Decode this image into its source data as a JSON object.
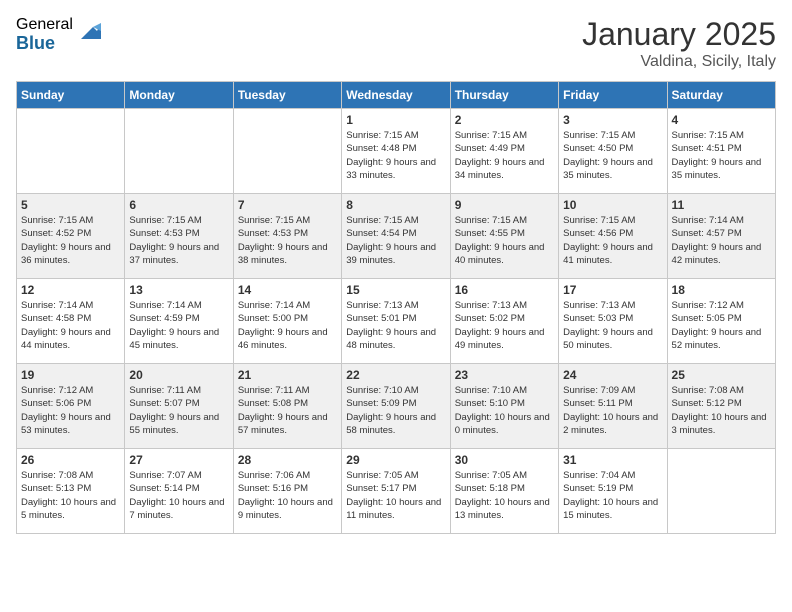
{
  "logo": {
    "general": "General",
    "blue": "Blue"
  },
  "header": {
    "month": "January 2025",
    "location": "Valdina, Sicily, Italy"
  },
  "weekdays": [
    "Sunday",
    "Monday",
    "Tuesday",
    "Wednesday",
    "Thursday",
    "Friday",
    "Saturday"
  ],
  "weeks": [
    [
      null,
      null,
      null,
      {
        "day": "1",
        "sunrise": "7:15 AM",
        "sunset": "4:48 PM",
        "daylight": "9 hours and 33 minutes."
      },
      {
        "day": "2",
        "sunrise": "7:15 AM",
        "sunset": "4:49 PM",
        "daylight": "9 hours and 34 minutes."
      },
      {
        "day": "3",
        "sunrise": "7:15 AM",
        "sunset": "4:50 PM",
        "daylight": "9 hours and 35 minutes."
      },
      {
        "day": "4",
        "sunrise": "7:15 AM",
        "sunset": "4:51 PM",
        "daylight": "9 hours and 35 minutes."
      }
    ],
    [
      {
        "day": "5",
        "sunrise": "7:15 AM",
        "sunset": "4:52 PM",
        "daylight": "9 hours and 36 minutes."
      },
      {
        "day": "6",
        "sunrise": "7:15 AM",
        "sunset": "4:53 PM",
        "daylight": "9 hours and 37 minutes."
      },
      {
        "day": "7",
        "sunrise": "7:15 AM",
        "sunset": "4:53 PM",
        "daylight": "9 hours and 38 minutes."
      },
      {
        "day": "8",
        "sunrise": "7:15 AM",
        "sunset": "4:54 PM",
        "daylight": "9 hours and 39 minutes."
      },
      {
        "day": "9",
        "sunrise": "7:15 AM",
        "sunset": "4:55 PM",
        "daylight": "9 hours and 40 minutes."
      },
      {
        "day": "10",
        "sunrise": "7:15 AM",
        "sunset": "4:56 PM",
        "daylight": "9 hours and 41 minutes."
      },
      {
        "day": "11",
        "sunrise": "7:14 AM",
        "sunset": "4:57 PM",
        "daylight": "9 hours and 42 minutes."
      }
    ],
    [
      {
        "day": "12",
        "sunrise": "7:14 AM",
        "sunset": "4:58 PM",
        "daylight": "9 hours and 44 minutes."
      },
      {
        "day": "13",
        "sunrise": "7:14 AM",
        "sunset": "4:59 PM",
        "daylight": "9 hours and 45 minutes."
      },
      {
        "day": "14",
        "sunrise": "7:14 AM",
        "sunset": "5:00 PM",
        "daylight": "9 hours and 46 minutes."
      },
      {
        "day": "15",
        "sunrise": "7:13 AM",
        "sunset": "5:01 PM",
        "daylight": "9 hours and 48 minutes."
      },
      {
        "day": "16",
        "sunrise": "7:13 AM",
        "sunset": "5:02 PM",
        "daylight": "9 hours and 49 minutes."
      },
      {
        "day": "17",
        "sunrise": "7:13 AM",
        "sunset": "5:03 PM",
        "daylight": "9 hours and 50 minutes."
      },
      {
        "day": "18",
        "sunrise": "7:12 AM",
        "sunset": "5:05 PM",
        "daylight": "9 hours and 52 minutes."
      }
    ],
    [
      {
        "day": "19",
        "sunrise": "7:12 AM",
        "sunset": "5:06 PM",
        "daylight": "9 hours and 53 minutes."
      },
      {
        "day": "20",
        "sunrise": "7:11 AM",
        "sunset": "5:07 PM",
        "daylight": "9 hours and 55 minutes."
      },
      {
        "day": "21",
        "sunrise": "7:11 AM",
        "sunset": "5:08 PM",
        "daylight": "9 hours and 57 minutes."
      },
      {
        "day": "22",
        "sunrise": "7:10 AM",
        "sunset": "5:09 PM",
        "daylight": "9 hours and 58 minutes."
      },
      {
        "day": "23",
        "sunrise": "7:10 AM",
        "sunset": "5:10 PM",
        "daylight": "10 hours and 0 minutes."
      },
      {
        "day": "24",
        "sunrise": "7:09 AM",
        "sunset": "5:11 PM",
        "daylight": "10 hours and 2 minutes."
      },
      {
        "day": "25",
        "sunrise": "7:08 AM",
        "sunset": "5:12 PM",
        "daylight": "10 hours and 3 minutes."
      }
    ],
    [
      {
        "day": "26",
        "sunrise": "7:08 AM",
        "sunset": "5:13 PM",
        "daylight": "10 hours and 5 minutes."
      },
      {
        "day": "27",
        "sunrise": "7:07 AM",
        "sunset": "5:14 PM",
        "daylight": "10 hours and 7 minutes."
      },
      {
        "day": "28",
        "sunrise": "7:06 AM",
        "sunset": "5:16 PM",
        "daylight": "10 hours and 9 minutes."
      },
      {
        "day": "29",
        "sunrise": "7:05 AM",
        "sunset": "5:17 PM",
        "daylight": "10 hours and 11 minutes."
      },
      {
        "day": "30",
        "sunrise": "7:05 AM",
        "sunset": "5:18 PM",
        "daylight": "10 hours and 13 minutes."
      },
      {
        "day": "31",
        "sunrise": "7:04 AM",
        "sunset": "5:19 PM",
        "daylight": "10 hours and 15 minutes."
      },
      null
    ]
  ]
}
